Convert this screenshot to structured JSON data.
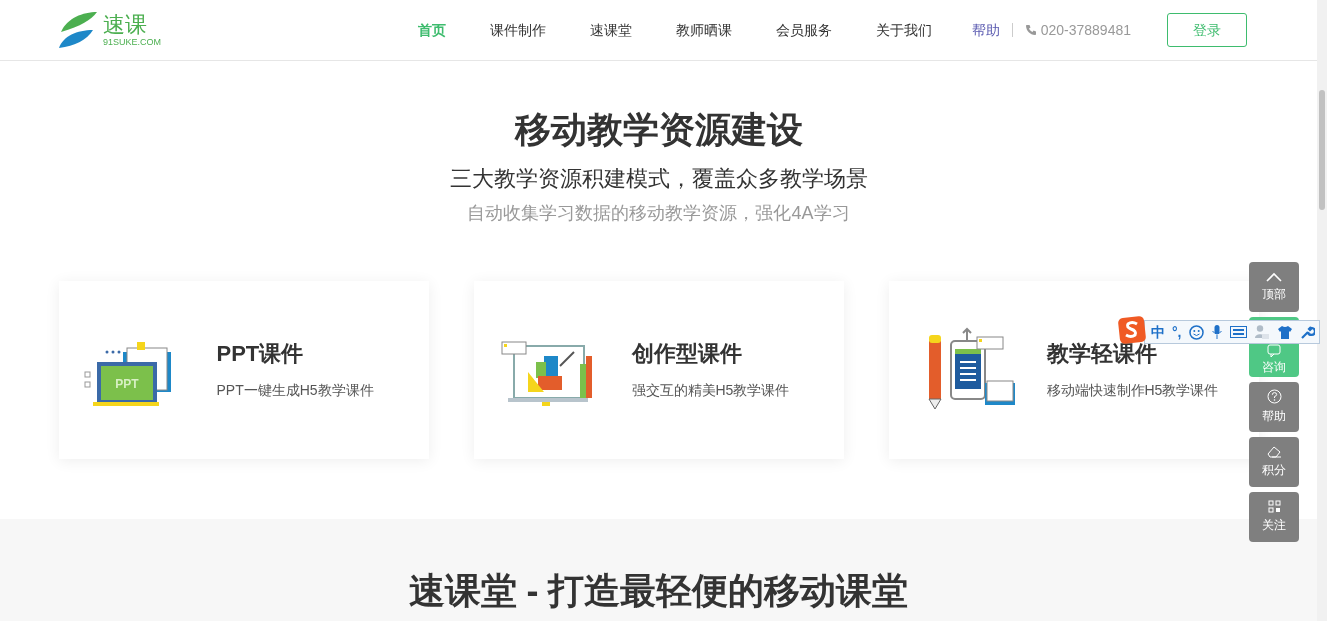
{
  "logo": {
    "name": "速课",
    "domain": "91SUKE.COM"
  },
  "nav": [
    {
      "label": "首页",
      "selected": true
    },
    {
      "label": "课件制作",
      "selected": false
    },
    {
      "label": "速课堂",
      "selected": false
    },
    {
      "label": "教师晒课",
      "selected": false
    },
    {
      "label": "会员服务",
      "selected": false
    },
    {
      "label": "关于我们",
      "selected": false
    }
  ],
  "help_link": "帮助",
  "phone": "020-37889481",
  "login_button": "登录",
  "hero": {
    "title": "移动教学资源建设",
    "subtitle": "三大教学资源积建模式，覆盖众多教学场景",
    "note": "自动收集学习数据的移动教学资源，强化4A学习"
  },
  "cards": [
    {
      "kind": "ppt",
      "title": "PPT课件",
      "badge": "PPT",
      "description": "PPT一键生成H5教学课件"
    },
    {
      "kind": "creative",
      "title": "创作型课件",
      "description": "强交互的精美H5教学课件"
    },
    {
      "kind": "mobile",
      "title": "教学轻课件",
      "description": "移动端快速制作H5教学课件"
    }
  ],
  "section2": {
    "title": "速课堂 - 打造最轻便的移动课堂"
  },
  "side_tools": [
    {
      "kind": "top",
      "label": "顶部"
    },
    {
      "kind": "chat",
      "label": "咨询"
    },
    {
      "kind": "help",
      "label": "帮助"
    },
    {
      "kind": "points",
      "label": "积分"
    },
    {
      "kind": "qr",
      "label": "关注"
    }
  ],
  "ime_toolbar": {
    "mode": "中",
    "punctuation": "°,"
  }
}
